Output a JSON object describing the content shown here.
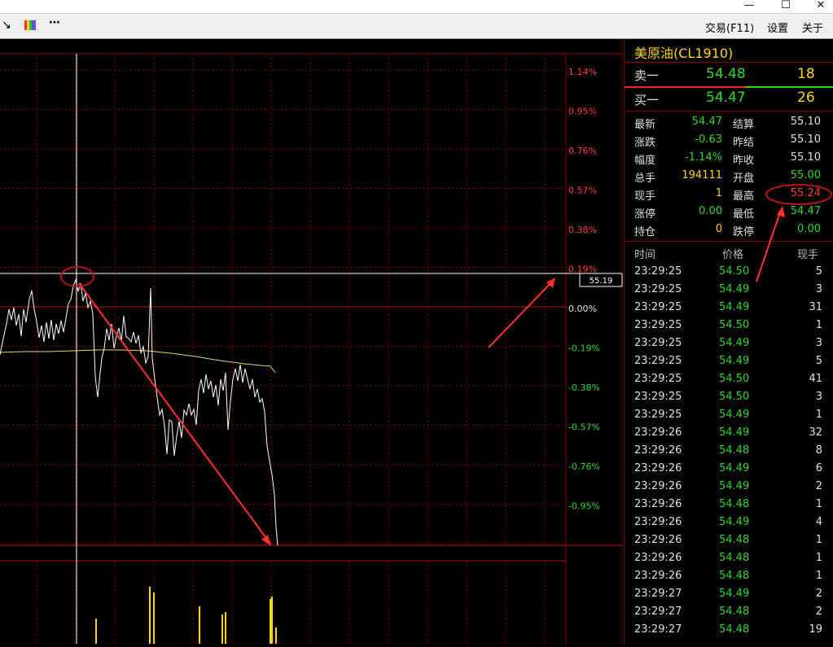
{
  "toolbar": {
    "trade_label": "交易(F11)",
    "settings_label": "设置",
    "about_label": "关于"
  },
  "window": {
    "minimize": "—",
    "maximize": "☐",
    "close": "✕"
  },
  "axis": {
    "percent_ticks": [
      "1.14%",
      "0.95%",
      "0.76%",
      "0.57%",
      "0.38%",
      "0.19%",
      "0.00%",
      "-0.19%",
      "-0.38%",
      "-0.57%",
      "-0.76%",
      "-0.95%"
    ],
    "crosshair_price": "55.19"
  },
  "quote": {
    "symbol": "美原油(CL1910)",
    "ask": {
      "label": "卖一",
      "price": "54.48",
      "volume": "18"
    },
    "bid": {
      "label": "买一",
      "price": "54.47",
      "volume": "26"
    },
    "stats": [
      {
        "l1": "最新",
        "v1": "54.47",
        "c1": "g",
        "l2": "结算",
        "v2": "55.10",
        "c2": "w"
      },
      {
        "l1": "涨跌",
        "v1": "-0.63",
        "c1": "g",
        "l2": "昨结",
        "v2": "55.10",
        "c2": "w"
      },
      {
        "l1": "幅度",
        "v1": "-1.14%",
        "c1": "g",
        "l2": "昨收",
        "v2": "55.10",
        "c2": "w"
      },
      {
        "l1": "总手",
        "v1": "194111",
        "c1": "y",
        "l2": "开盘",
        "v2": "55.00",
        "c2": "g"
      },
      {
        "l1": "现手",
        "v1": "1",
        "c1": "y",
        "l2": "最高",
        "v2": "55.24",
        "c2": "r"
      },
      {
        "l1": "涨停",
        "v1": "0.00",
        "c1": "g",
        "l2": "最低",
        "v2": "54.47",
        "c2": "g"
      },
      {
        "l1": "持仓",
        "v1": "0",
        "c1": "y",
        "l2": "跌停",
        "v2": "0.00",
        "c2": "g"
      }
    ]
  },
  "ticks": {
    "headers": {
      "time": "时间",
      "price": "价格",
      "volume": "现手"
    },
    "rows": [
      {
        "time": "23:29:25",
        "price": "54.50",
        "volume": "5"
      },
      {
        "time": "23:29:25",
        "price": "54.49",
        "volume": "3"
      },
      {
        "time": "23:29:25",
        "price": "54.49",
        "volume": "31"
      },
      {
        "time": "23:29:25",
        "price": "54.50",
        "volume": "1"
      },
      {
        "time": "23:29:25",
        "price": "54.49",
        "volume": "3"
      },
      {
        "time": "23:29:25",
        "price": "54.49",
        "volume": "5"
      },
      {
        "time": "23:29:25",
        "price": "54.50",
        "volume": "41"
      },
      {
        "time": "23:29:25",
        "price": "54.50",
        "volume": "3"
      },
      {
        "time": "23:29:25",
        "price": "54.49",
        "volume": "1"
      },
      {
        "time": "23:29:26",
        "price": "54.49",
        "volume": "32"
      },
      {
        "time": "23:29:26",
        "price": "54.48",
        "volume": "8"
      },
      {
        "time": "23:29:26",
        "price": "54.49",
        "volume": "6"
      },
      {
        "time": "23:29:26",
        "price": "54.49",
        "volume": "2"
      },
      {
        "time": "23:29:26",
        "price": "54.48",
        "volume": "1"
      },
      {
        "time": "23:29:26",
        "price": "54.49",
        "volume": "4"
      },
      {
        "time": "23:29:26",
        "price": "54.48",
        "volume": "1"
      },
      {
        "time": "23:29:26",
        "price": "54.48",
        "volume": "1"
      },
      {
        "time": "23:29:26",
        "price": "54.48",
        "volume": "1"
      },
      {
        "time": "23:29:27",
        "price": "54.49",
        "volume": "2"
      },
      {
        "time": "23:29:27",
        "price": "54.48",
        "volume": "2"
      },
      {
        "time": "23:29:27",
        "price": "54.48",
        "volume": "19"
      }
    ]
  },
  "colors": {
    "up": "#ff3b3b",
    "down": "#27d827",
    "grid": "#8b0000",
    "price_line": "#ffffff",
    "avg_line": "#e6d85a"
  }
}
